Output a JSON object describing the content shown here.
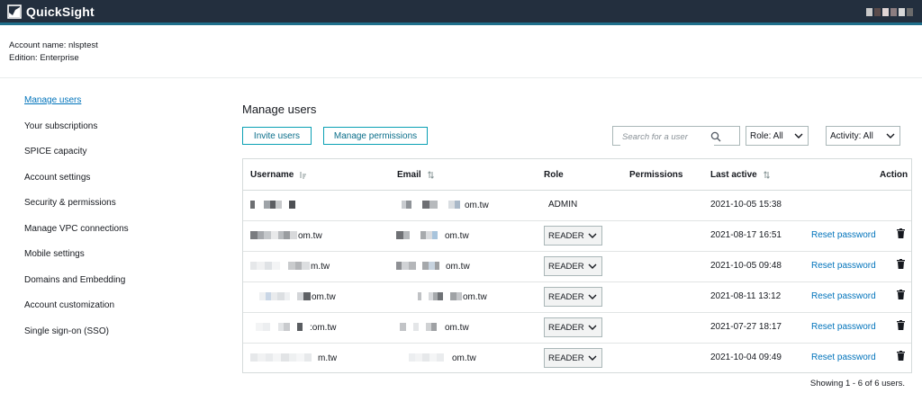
{
  "app": {
    "brand": "QuickSight"
  },
  "account": {
    "name_line": "Account name: nlsptest",
    "edition_line": "Edition: Enterprise"
  },
  "sidebar": {
    "items": [
      {
        "label": "Manage users",
        "active": true
      },
      {
        "label": "Your subscriptions"
      },
      {
        "label": "SPICE capacity"
      },
      {
        "label": "Account settings"
      },
      {
        "label": "Security & permissions"
      },
      {
        "label": "Manage VPC connections"
      },
      {
        "label": "Mobile settings"
      },
      {
        "label": "Domains and Embedding"
      },
      {
        "label": "Account customization"
      },
      {
        "label": "Single sign-on (SSO)"
      }
    ]
  },
  "main": {
    "title": "Manage users",
    "invite_label": "Invite users",
    "permissions_label": "Manage permissions",
    "search_placeholder": "Search for a user",
    "role_filter": "Role: All",
    "activity_filter": "Activity: All"
  },
  "table": {
    "headers": {
      "username": "Username",
      "email": "Email",
      "role": "Role",
      "permissions": "Permissions",
      "last_active": "Last active",
      "action": "Action"
    },
    "rows": [
      {
        "username_visible": "",
        "email_visible": "om.tw",
        "role": "ADMIN",
        "role_editable": false,
        "last_active": "2021-10-05 15:38",
        "action": ""
      },
      {
        "username_visible": "om.tw",
        "email_visible": "om.tw",
        "role": "READER",
        "role_editable": true,
        "last_active": "2021-08-17 16:51",
        "action": "Reset password"
      },
      {
        "username_visible": "m.tw",
        "email_visible": "om.tw",
        "role": "READER",
        "role_editable": true,
        "last_active": "2021-10-05 09:48",
        "action": "Reset password"
      },
      {
        "username_visible": "om.tw",
        "email_visible": "om.tw",
        "role": "READER",
        "role_editable": true,
        "last_active": "2021-08-11 13:12",
        "action": "Reset password"
      },
      {
        "username_visible": ":om.tw",
        "email_visible": "om.tw",
        "role": "READER",
        "role_editable": true,
        "last_active": "2021-07-27 18:17",
        "action": "Reset password"
      },
      {
        "username_visible": "m.tw",
        "email_visible": "om.tw",
        "role": "READER",
        "role_editable": true,
        "last_active": "2021-10-04 09:49",
        "action": "Reset password"
      }
    ],
    "footer": "Showing 1 - 6 of 6 users."
  },
  "colors": {
    "topbar": "#232f3e",
    "accent": "#0073bb",
    "button_border": "#0aa0b4"
  },
  "icons": {
    "logo": "quicksight-logo-icon",
    "search": "search-icon",
    "sort": "sort-icon",
    "chevron": "chevron-down-icon",
    "trash": "trash-icon"
  }
}
